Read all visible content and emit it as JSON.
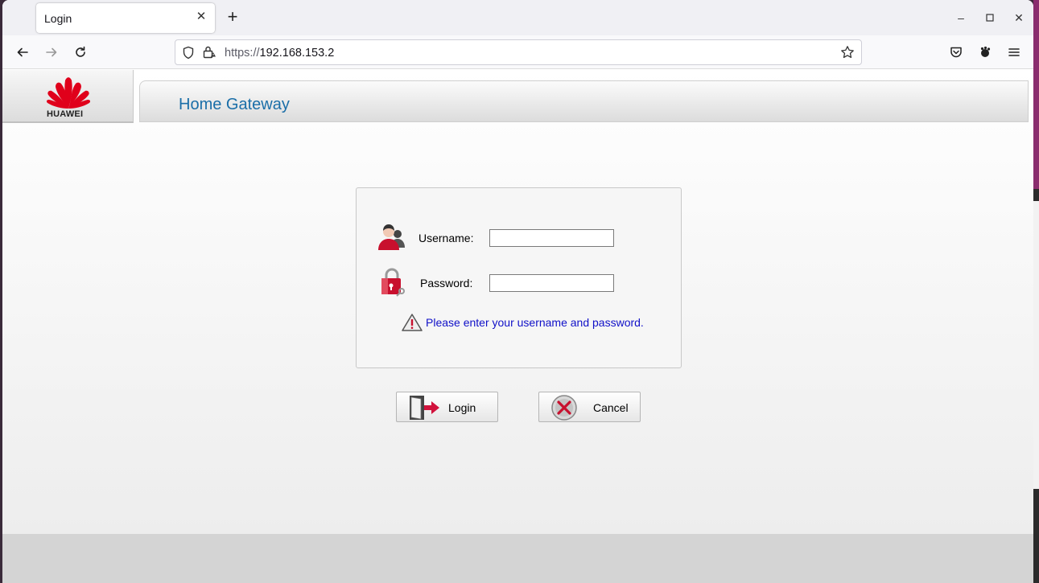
{
  "browser": {
    "tab_title": "Login",
    "url_scheme": "https://",
    "url_host": "192.168.153.2"
  },
  "header": {
    "brand": "HUAWEI",
    "title": "Home Gateway"
  },
  "login": {
    "username_label": "Username:",
    "username_value": "",
    "password_label": "Password:",
    "password_value": "",
    "hint": "Please enter your username and password."
  },
  "buttons": {
    "login_label": "Login",
    "cancel_label": "Cancel"
  },
  "colors": {
    "brand_red": "#e0001b",
    "title_blue": "#1a6ea8",
    "hint_blue": "#1010c8"
  }
}
